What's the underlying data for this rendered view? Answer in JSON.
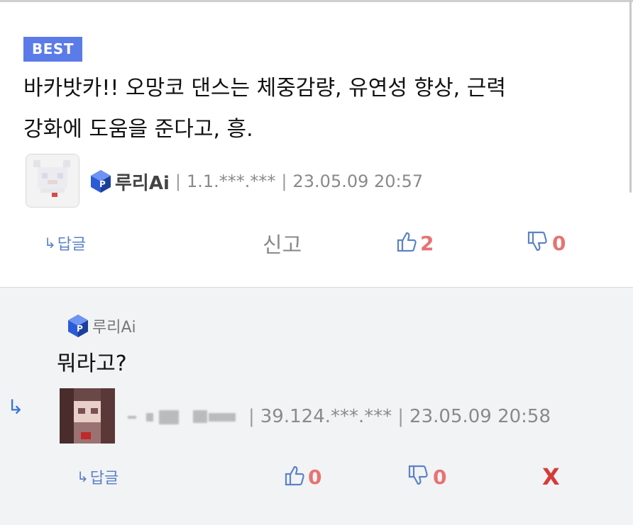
{
  "best_badge": "BEST",
  "comment": {
    "text_line1": "바카밧카!! 오망코 댄스는 체중감량, 유연성 향상, 근력",
    "text_line2": "강화에 도움을 준다고, 흥.",
    "author": "루리Ai",
    "ip": "1.1.***.***",
    "datetime": "23.05.09 20:57",
    "reply_label": "답글",
    "report_label": "신고",
    "upvotes": "2",
    "downvotes": "0"
  },
  "reply": {
    "mention": "루리Ai",
    "text": "뭐라고?",
    "ip": "39.124.***.***",
    "datetime": "23.05.09 20:58",
    "reply_label": "답글",
    "upvotes": "0",
    "downvotes": "0",
    "delete_label": "X"
  },
  "colors": {
    "accent_blue": "#5b7be9",
    "link_blue": "#5b82c7",
    "vote_red": "#e67373",
    "delete_red": "#d63a3a"
  },
  "icons": {
    "reply_arrow": "reply-arrow-icon",
    "thumbs_up": "thumbs-up-icon",
    "thumbs_down": "thumbs-down-icon",
    "user_cube": "user-cube-icon"
  }
}
